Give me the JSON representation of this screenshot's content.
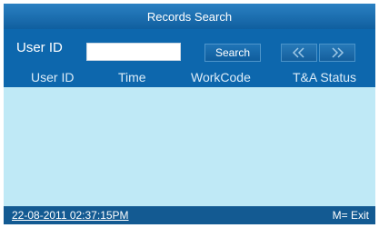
{
  "title": "Records Search",
  "search": {
    "user_id_label": "User ID",
    "user_id_value": "",
    "search_button": "Search",
    "prev_icon": "double-left-chevron-icon",
    "next_icon": "double-right-chevron-icon"
  },
  "table": {
    "columns": [
      "User ID",
      "Time",
      "WorkCode",
      "T&A Status"
    ],
    "rows": []
  },
  "status_bar": {
    "datetime": "22-08-2011  02:37:15PM",
    "exit_hint": "M= Exit"
  },
  "colors": {
    "header_blue": "#0d67ad",
    "body_light_blue": "#bfe9f6",
    "status_bar": "#135a92"
  }
}
